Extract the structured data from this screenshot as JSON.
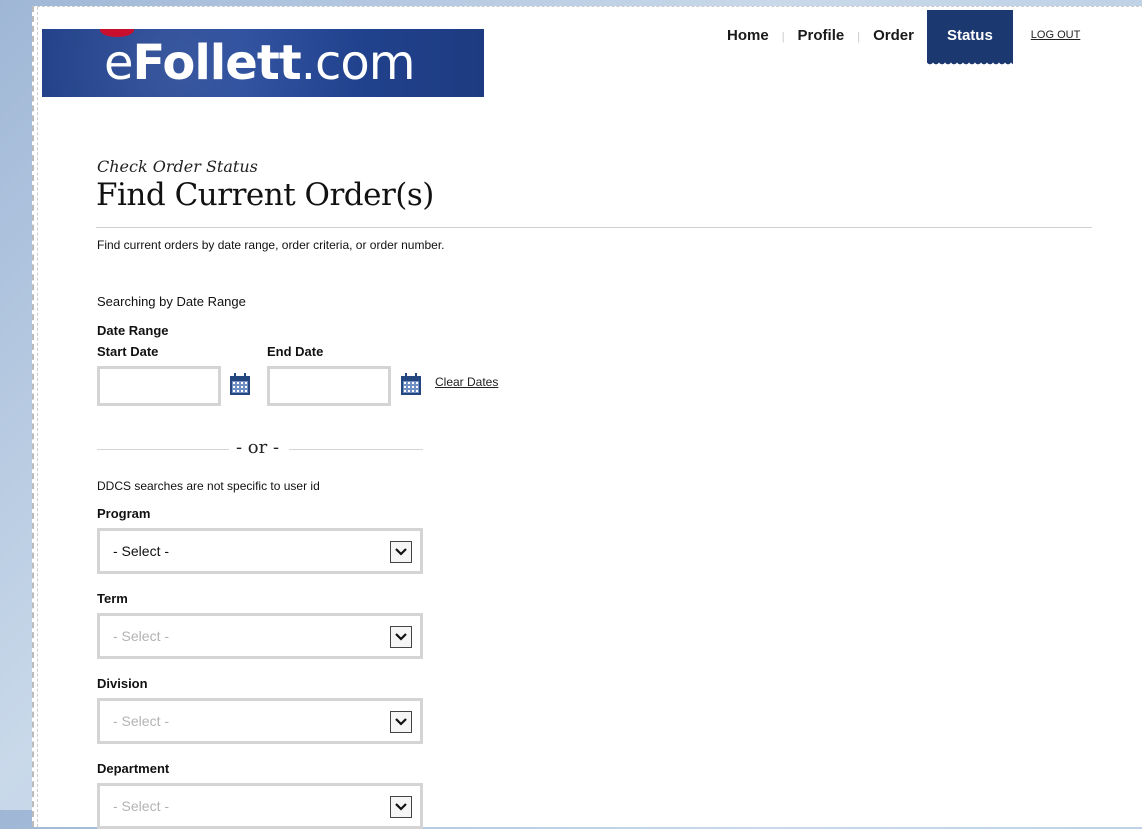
{
  "logo": {
    "prefix": "e",
    "bold": "Follett",
    "suffix": ".com"
  },
  "nav": {
    "items": [
      {
        "label": "Home"
      },
      {
        "label": "Profile"
      },
      {
        "label": "Order"
      },
      {
        "label": "Status",
        "active": true
      }
    ],
    "logout": "LOG OUT"
  },
  "page": {
    "subheading": "Check Order Status",
    "title": "Find Current Order(s)",
    "intro": "Find current orders by date range, order criteria, or order number."
  },
  "date_search": {
    "mode_text": "Searching by Date Range",
    "section_label": "Date Range",
    "start_label": "Start Date",
    "end_label": "End Date",
    "start_value": "",
    "end_value": "",
    "clear_label": "Clear Dates"
  },
  "divider": {
    "text": "- or -"
  },
  "criteria": {
    "note": "DDCS searches are not specific to user id",
    "fields": [
      {
        "label": "Program",
        "value": "- Select -",
        "enabled": true
      },
      {
        "label": "Term",
        "value": "- Select -",
        "enabled": false
      },
      {
        "label": "Division",
        "value": "- Select -",
        "enabled": false
      },
      {
        "label": "Department",
        "value": "- Select -",
        "enabled": false
      }
    ]
  },
  "colors": {
    "brand_navy": "#1c3870",
    "logo_blue": "#25489a",
    "calendar_icon": "#24477f"
  }
}
